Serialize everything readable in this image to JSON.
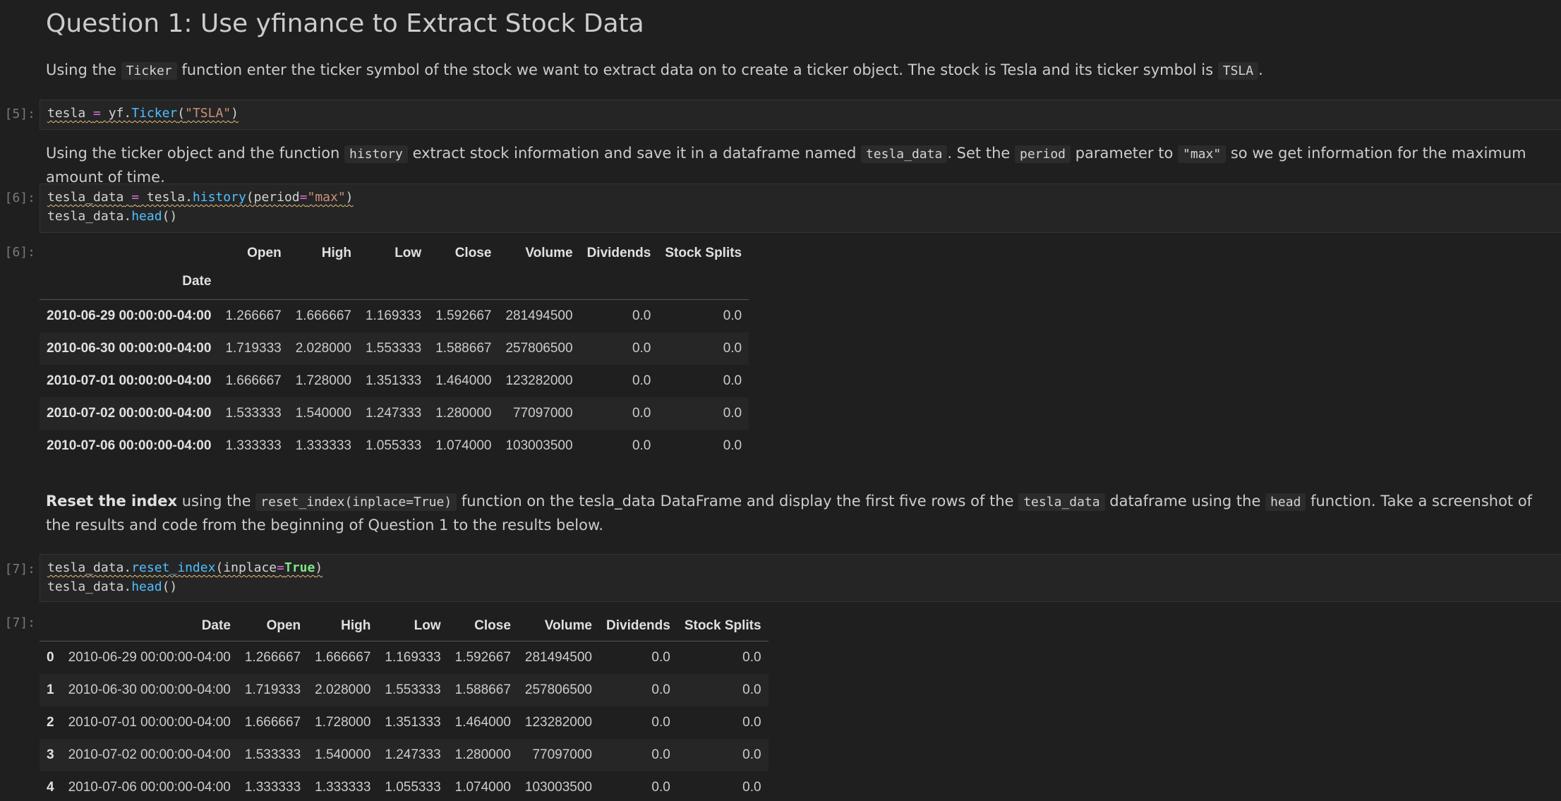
{
  "heading": "Question 1: Use yfinance to Extract Stock Data",
  "para1": {
    "t1": "Using the ",
    "c1": "Ticker",
    "t2": " function enter the ticker symbol of the stock we want to extract data on to create a ticker object. The stock is Tesla and its ticker symbol is ",
    "c2": "TSLA",
    "t3": "."
  },
  "cell5": {
    "prompt": "[5]:",
    "lines": [
      [
        {
          "t": "tesla",
          "c": "var",
          "s": true
        },
        {
          "t": " ",
          "c": "var",
          "s": true
        },
        {
          "t": "=",
          "c": "op",
          "s": true
        },
        {
          "t": " yf.",
          "c": "var",
          "s": true
        },
        {
          "t": "Ticker",
          "c": "fn",
          "s": true
        },
        {
          "t": "(",
          "c": "var",
          "s": true
        },
        {
          "t": "\"TSLA\"",
          "c": "str",
          "s": true
        },
        {
          "t": ")",
          "c": "var",
          "s": true
        }
      ]
    ]
  },
  "para2": {
    "t1": "Using the ticker object and the function ",
    "c1": "history",
    "t2": " extract stock information and save it in a dataframe named ",
    "c2": "tesla_data",
    "t3": ". Set the ",
    "c3": "period",
    "t4": " parameter to ",
    "c4": "\"max\"",
    "t5": " so we get information for the maximum amount of time."
  },
  "cell6": {
    "prompt": "[6]:",
    "lines": [
      [
        {
          "t": "tesla_data",
          "c": "var",
          "s": true
        },
        {
          "t": " ",
          "c": "var",
          "s": true
        },
        {
          "t": "=",
          "c": "op",
          "s": true
        },
        {
          "t": " tesla.",
          "c": "var",
          "s": true
        },
        {
          "t": "history",
          "c": "fn",
          "s": true
        },
        {
          "t": "(period",
          "c": "var",
          "s": true
        },
        {
          "t": "=",
          "c": "op",
          "s": true
        },
        {
          "t": "\"max\"",
          "c": "str",
          "s": true
        },
        {
          "t": ")",
          "c": "var",
          "s": true
        }
      ],
      [
        {
          "t": "tesla_data.",
          "c": "var",
          "s": false
        },
        {
          "t": "head",
          "c": "fn",
          "s": false
        },
        {
          "t": "()",
          "c": "var",
          "s": false
        }
      ]
    ]
  },
  "out6": {
    "prompt": "[6]:",
    "columns": [
      "Open",
      "High",
      "Low",
      "Close",
      "Volume",
      "Dividends",
      "Stock Splits"
    ],
    "index_name": "Date",
    "rows": [
      {
        "idx": "2010-06-29 00:00:00-04:00",
        "vals": [
          "1.266667",
          "1.666667",
          "1.169333",
          "1.592667",
          "281494500",
          "0.0",
          "0.0"
        ]
      },
      {
        "idx": "2010-06-30 00:00:00-04:00",
        "vals": [
          "1.719333",
          "2.028000",
          "1.553333",
          "1.588667",
          "257806500",
          "0.0",
          "0.0"
        ]
      },
      {
        "idx": "2010-07-01 00:00:00-04:00",
        "vals": [
          "1.666667",
          "1.728000",
          "1.351333",
          "1.464000",
          "123282000",
          "0.0",
          "0.0"
        ]
      },
      {
        "idx": "2010-07-02 00:00:00-04:00",
        "vals": [
          "1.533333",
          "1.540000",
          "1.247333",
          "1.280000",
          "77097000",
          "0.0",
          "0.0"
        ]
      },
      {
        "idx": "2010-07-06 00:00:00-04:00",
        "vals": [
          "1.333333",
          "1.333333",
          "1.055333",
          "1.074000",
          "103003500",
          "0.0",
          "0.0"
        ]
      }
    ]
  },
  "para3": {
    "b1": "Reset the index",
    "t1": " using the ",
    "c1": "reset_index(inplace=True)",
    "t2": " function on the tesla_data DataFrame and display the first five rows of the ",
    "c2": "tesla_data",
    "t3": " dataframe using the ",
    "c3": "head",
    "t4": " function. Take a screenshot of the results and code from the beginning of Question 1 to the results below."
  },
  "cell7": {
    "prompt": "[7]:",
    "lines": [
      [
        {
          "t": "tesla_data.",
          "c": "var",
          "s": true
        },
        {
          "t": "reset_index",
          "c": "fn",
          "s": true
        },
        {
          "t": "(inplace",
          "c": "var",
          "s": true
        },
        {
          "t": "=",
          "c": "op",
          "s": true
        },
        {
          "t": "True",
          "c": "kw",
          "s": true
        },
        {
          "t": ")",
          "c": "var",
          "s": true
        }
      ],
      [
        {
          "t": "tesla_data.",
          "c": "var",
          "s": false
        },
        {
          "t": "head",
          "c": "fn",
          "s": false
        },
        {
          "t": "()",
          "c": "var",
          "s": false
        }
      ]
    ]
  },
  "out7": {
    "prompt": "[7]:",
    "columns": [
      "Date",
      "Open",
      "High",
      "Low",
      "Close",
      "Volume",
      "Dividends",
      "Stock Splits"
    ],
    "rows": [
      {
        "idx": "0",
        "vals": [
          "2010-06-29 00:00:00-04:00",
          "1.266667",
          "1.666667",
          "1.169333",
          "1.592667",
          "281494500",
          "0.0",
          "0.0"
        ]
      },
      {
        "idx": "1",
        "vals": [
          "2010-06-30 00:00:00-04:00",
          "1.719333",
          "2.028000",
          "1.553333",
          "1.588667",
          "257806500",
          "0.0",
          "0.0"
        ]
      },
      {
        "idx": "2",
        "vals": [
          "2010-07-01 00:00:00-04:00",
          "1.666667",
          "1.728000",
          "1.351333",
          "1.464000",
          "123282000",
          "0.0",
          "0.0"
        ]
      },
      {
        "idx": "3",
        "vals": [
          "2010-07-02 00:00:00-04:00",
          "1.533333",
          "1.540000",
          "1.247333",
          "1.280000",
          "77097000",
          "0.0",
          "0.0"
        ]
      },
      {
        "idx": "4",
        "vals": [
          "2010-07-06 00:00:00-04:00",
          "1.333333",
          "1.333333",
          "1.055333",
          "1.074000",
          "103003500",
          "0.0",
          "0.0"
        ]
      }
    ]
  }
}
